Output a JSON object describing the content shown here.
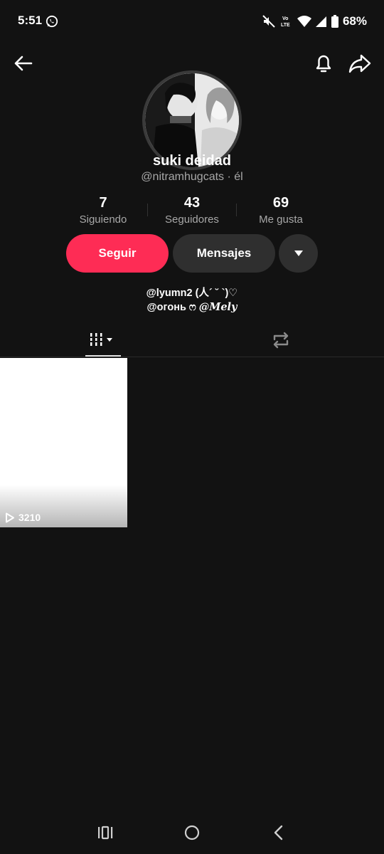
{
  "status_bar": {
    "time": "5:51",
    "battery": "68%",
    "icons": [
      "whatsapp-icon",
      "mute-icon",
      "volte-icon",
      "wifi-icon",
      "signal-icon",
      "battery-icon"
    ]
  },
  "nav": {
    "icons": [
      "back-arrow-icon",
      "bell-icon",
      "share-icon"
    ]
  },
  "profile": {
    "display_name": "suki deidad",
    "handle": "@nitramhugcats · él"
  },
  "stats": [
    {
      "value": "7",
      "label": "Siguiendo"
    },
    {
      "value": "43",
      "label": "Seguidores"
    },
    {
      "value": "69",
      "label": "Me gusta"
    }
  ],
  "actions": {
    "follow": "Seguir",
    "message": "Mensajes",
    "more_icon": "caret-down-icon"
  },
  "bio": {
    "line1": "@lyumn2 (人´ ˘ `)♡",
    "line2_prefix": "@огонь ෆ ",
    "line2_script": "@Mely"
  },
  "tabs": [
    {
      "name": "videos",
      "icon": "grid-icon",
      "active": true
    },
    {
      "name": "reposts",
      "icon": "repost-icon",
      "active": false
    }
  ],
  "videos": [
    {
      "views": "3210"
    }
  ],
  "colors": {
    "background": "#121212",
    "follow": "#fe2c55",
    "secondary_button": "#2f2f2f",
    "muted_text": "#a8a8a8"
  },
  "system_nav": [
    "recents-icon",
    "home-icon",
    "back-icon"
  ]
}
